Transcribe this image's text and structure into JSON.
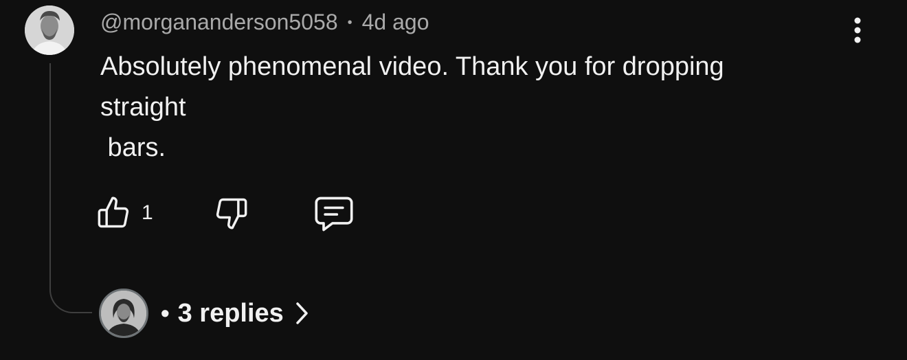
{
  "comment": {
    "author": "@morgananderson5058",
    "separator": "•",
    "timestamp": "4d ago",
    "text_lines": [
      "Absolutely phenomenal video. Thank you for dropping",
      "straight",
      " bars."
    ],
    "like_count": "1"
  },
  "actions": {
    "like_icon": "thumbs-up-icon",
    "dislike_icon": "thumbs-down-icon",
    "reply_icon": "comment-reply-icon",
    "menu_icon": "more-vertical-icon"
  },
  "replies": {
    "separator": "•",
    "label": "3 replies",
    "chevron_icon": "chevron-right-icon"
  },
  "colors": {
    "background": "#0f0f0f",
    "text_primary": "#f1f1f1",
    "text_secondary": "#aaaaaa",
    "thread_line": "#3f3f3f"
  }
}
